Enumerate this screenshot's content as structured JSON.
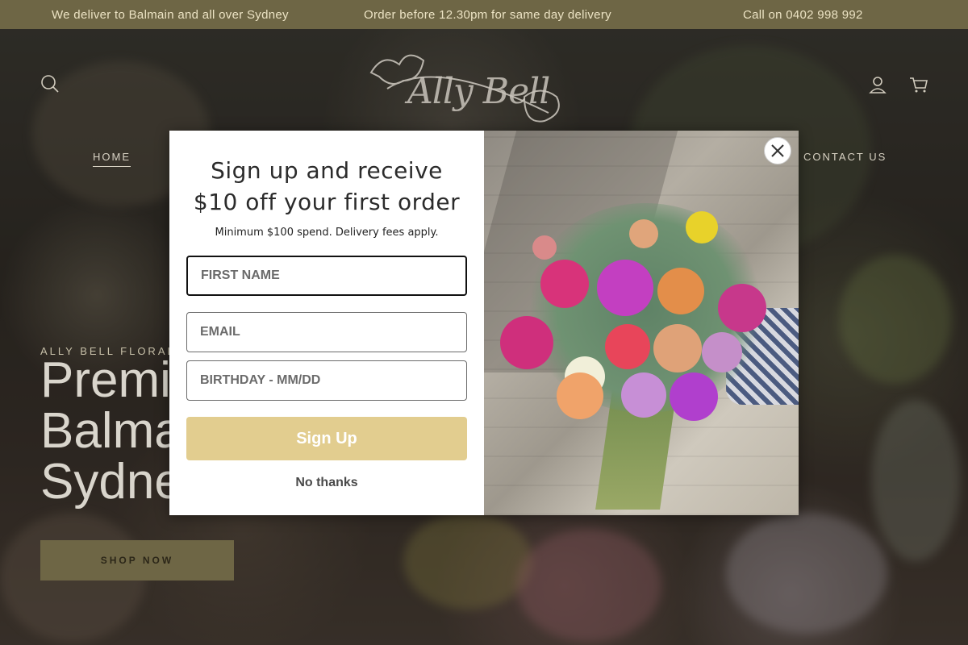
{
  "announcement": {
    "item1": "We deliver to Balmain and all over Sydney",
    "item2": "Order before 12.30pm for same day delivery",
    "item3": "Call on 0402 998 992"
  },
  "header": {
    "logo_text": "Ally Bell",
    "nav_home": "HOME",
    "nav_contact": "CONTACT US"
  },
  "hero": {
    "kicker": "ALLY BELL FLORAL",
    "headline_line1": "Premi",
    "headline_line2": "Balma",
    "headline_line3": "Sydne",
    "shop_button": "SHOP NOW"
  },
  "modal": {
    "title_line1": "Sign up and receive",
    "title_line2": "$10 off your first order",
    "subtitle": "Minimum $100 spend. Delivery fees apply.",
    "first_name_placeholder": "FIRST NAME",
    "email_placeholder": "EMAIL",
    "birthday_placeholder": "BIRTHDAY - MM/DD",
    "signup_label": "Sign Up",
    "no_thanks_label": "No thanks"
  },
  "colors": {
    "announcement_bg": "#6e6645",
    "signup_button": "#e2cd8f",
    "shop_button_bg": "#6e6645"
  },
  "icons": {
    "search": "search-icon",
    "account": "account-icon",
    "cart": "cart-icon",
    "close": "close-icon"
  }
}
